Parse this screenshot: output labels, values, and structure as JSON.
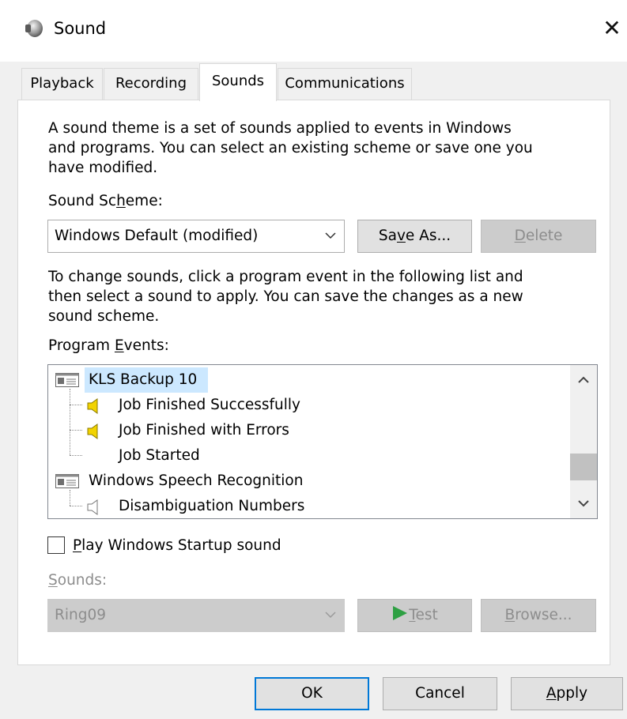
{
  "window": {
    "title": "Sound",
    "close_glyph": "✕"
  },
  "tabs": [
    {
      "label": "Playback",
      "active": false
    },
    {
      "label": "Recording",
      "active": false
    },
    {
      "label": "Sounds",
      "active": true
    },
    {
      "label": "Communications",
      "active": false
    }
  ],
  "sounds_tab": {
    "intro": "A sound theme is a set of sounds applied to events in Windows and programs.  You can select an existing scheme or save one you have modified.",
    "intro_lines": [
      "A sound theme is a set of sounds applied to events in Windows",
      "and programs.  You can select an existing scheme or save one you",
      "have modified."
    ],
    "scheme_label_pre": "Sound Sc",
    "scheme_label_key": "h",
    "scheme_label_post": "eme:",
    "scheme_value": "Windows Default (modified)",
    "save_as_pre": "Sa",
    "save_as_key": "v",
    "save_as_post": "e As...",
    "delete_key": "D",
    "delete_post": "elete",
    "instructions_lines": [
      "To change sounds, click a program event in the following list and",
      "then select a sound to apply.  You can save the changes as a new",
      "sound scheme."
    ],
    "events_label_pre": "Program ",
    "events_label_key": "E",
    "events_label_post": "vents:",
    "events": [
      {
        "label": "KLS Backup 10",
        "kind": "group",
        "selected": true
      },
      {
        "label": "Job Finished Successfully",
        "kind": "event",
        "has_sound": true
      },
      {
        "label": "Job Finished with Errors",
        "kind": "event",
        "has_sound": true
      },
      {
        "label": "Job Started",
        "kind": "event",
        "has_sound": false
      },
      {
        "label": "Windows Speech Recognition",
        "kind": "group",
        "selected": false
      },
      {
        "label": "Disambiguation Numbers",
        "kind": "event",
        "has_sound": false
      }
    ],
    "startup_checkbox_key": "P",
    "startup_checkbox_post": "lay Windows Startup sound",
    "startup_checked": false,
    "sounds_label_key": "S",
    "sounds_label_post": "ounds:",
    "sound_value": "Ring09",
    "test_key": "T",
    "test_post": "est",
    "browse_key": "B",
    "browse_post": "rowse..."
  },
  "footer": {
    "ok": "OK",
    "cancel": "Cancel",
    "apply_key": "A",
    "apply_post": "pply"
  },
  "colors": {
    "selection": "#cce8ff",
    "default_button_border": "#0078d7",
    "speaker_active": "#f2d300",
    "test_triangle": "#2ea043"
  }
}
